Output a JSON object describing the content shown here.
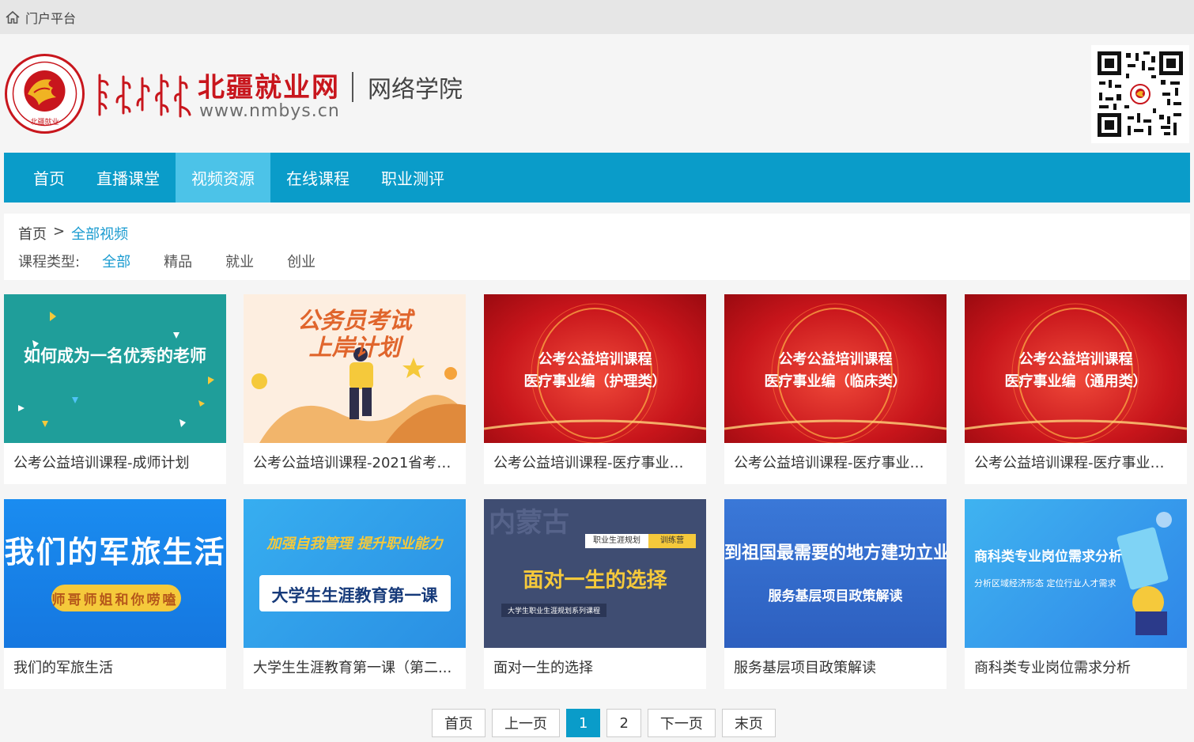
{
  "topbar": {
    "label": "门户平台",
    "icon": "home-icon"
  },
  "brand": {
    "name": "北疆就业网",
    "url": "www.nmbys.cn",
    "sub": "网络学院",
    "emblem_text": "北疆就业",
    "color": "#c8161d"
  },
  "nav": {
    "items": [
      {
        "label": "首页"
      },
      {
        "label": "直播课堂"
      },
      {
        "label": "视频资源",
        "active": true
      },
      {
        "label": "在线课程"
      },
      {
        "label": "职业测评"
      }
    ],
    "color": "#0a9cc9",
    "active_color": "#4cc3e8"
  },
  "breadcrumb": {
    "home": "首页",
    "sep": ">",
    "current": "全部视频"
  },
  "filter": {
    "label": "课程类型:",
    "options": [
      "全部",
      "精品",
      "就业",
      "创业"
    ],
    "selected": "全部"
  },
  "cards": [
    {
      "title": "公考公益培训课程-成师计划",
      "thumb": {
        "line1": "如何成为一名优秀的老师"
      }
    },
    {
      "title": "公考公益培训课程-2021省考上...",
      "thumb": {
        "line1": "公务员考试",
        "line2": "上岸计划"
      }
    },
    {
      "title": "公考公益培训课程-医疗事业编...",
      "thumb": {
        "line1": "公考公益培训课程",
        "line2": "医疗事业编（护理类）"
      }
    },
    {
      "title": "公考公益培训课程-医疗事业编...",
      "thumb": {
        "line1": "公考公益培训课程",
        "line2": "医疗事业编（临床类）"
      }
    },
    {
      "title": "公考公益培训课程-医疗事业编...",
      "thumb": {
        "line1": "公考公益培训课程",
        "line2": "医疗事业编（通用类）"
      }
    },
    {
      "title": "我们的军旅生活",
      "thumb": {
        "line1": "我们的军旅生活",
        "line2": "师哥师姐和你唠嗑"
      }
    },
    {
      "title": "大学生生涯教育第一课（第二...",
      "thumb": {
        "line1": "加强自我管理  提升职业能力",
        "line2": "大学生生涯教育第一课"
      }
    },
    {
      "title": "面对一生的选择",
      "thumb": {
        "line0": "内蒙古",
        "tag1": "职业生涯规划",
        "tag2": "训练营",
        "line1": "面对一生的选择",
        "line2": "大学生职业生涯规划系列课程"
      }
    },
    {
      "title": "服务基层项目政策解读",
      "thumb": {
        "line1": "到祖国最需要的地方建功立业",
        "line2": "服务基层项目政策解读"
      }
    },
    {
      "title": "商科类专业岗位需求分析",
      "thumb": {
        "line1": "商科类专业岗位需求分析",
        "line2": "分析区域经济形态 定位行业人才需求"
      }
    }
  ],
  "pager": {
    "first": "首页",
    "prev": "上一页",
    "pages": [
      "1",
      "2"
    ],
    "current": "1",
    "next": "下一页",
    "last": "末页"
  }
}
